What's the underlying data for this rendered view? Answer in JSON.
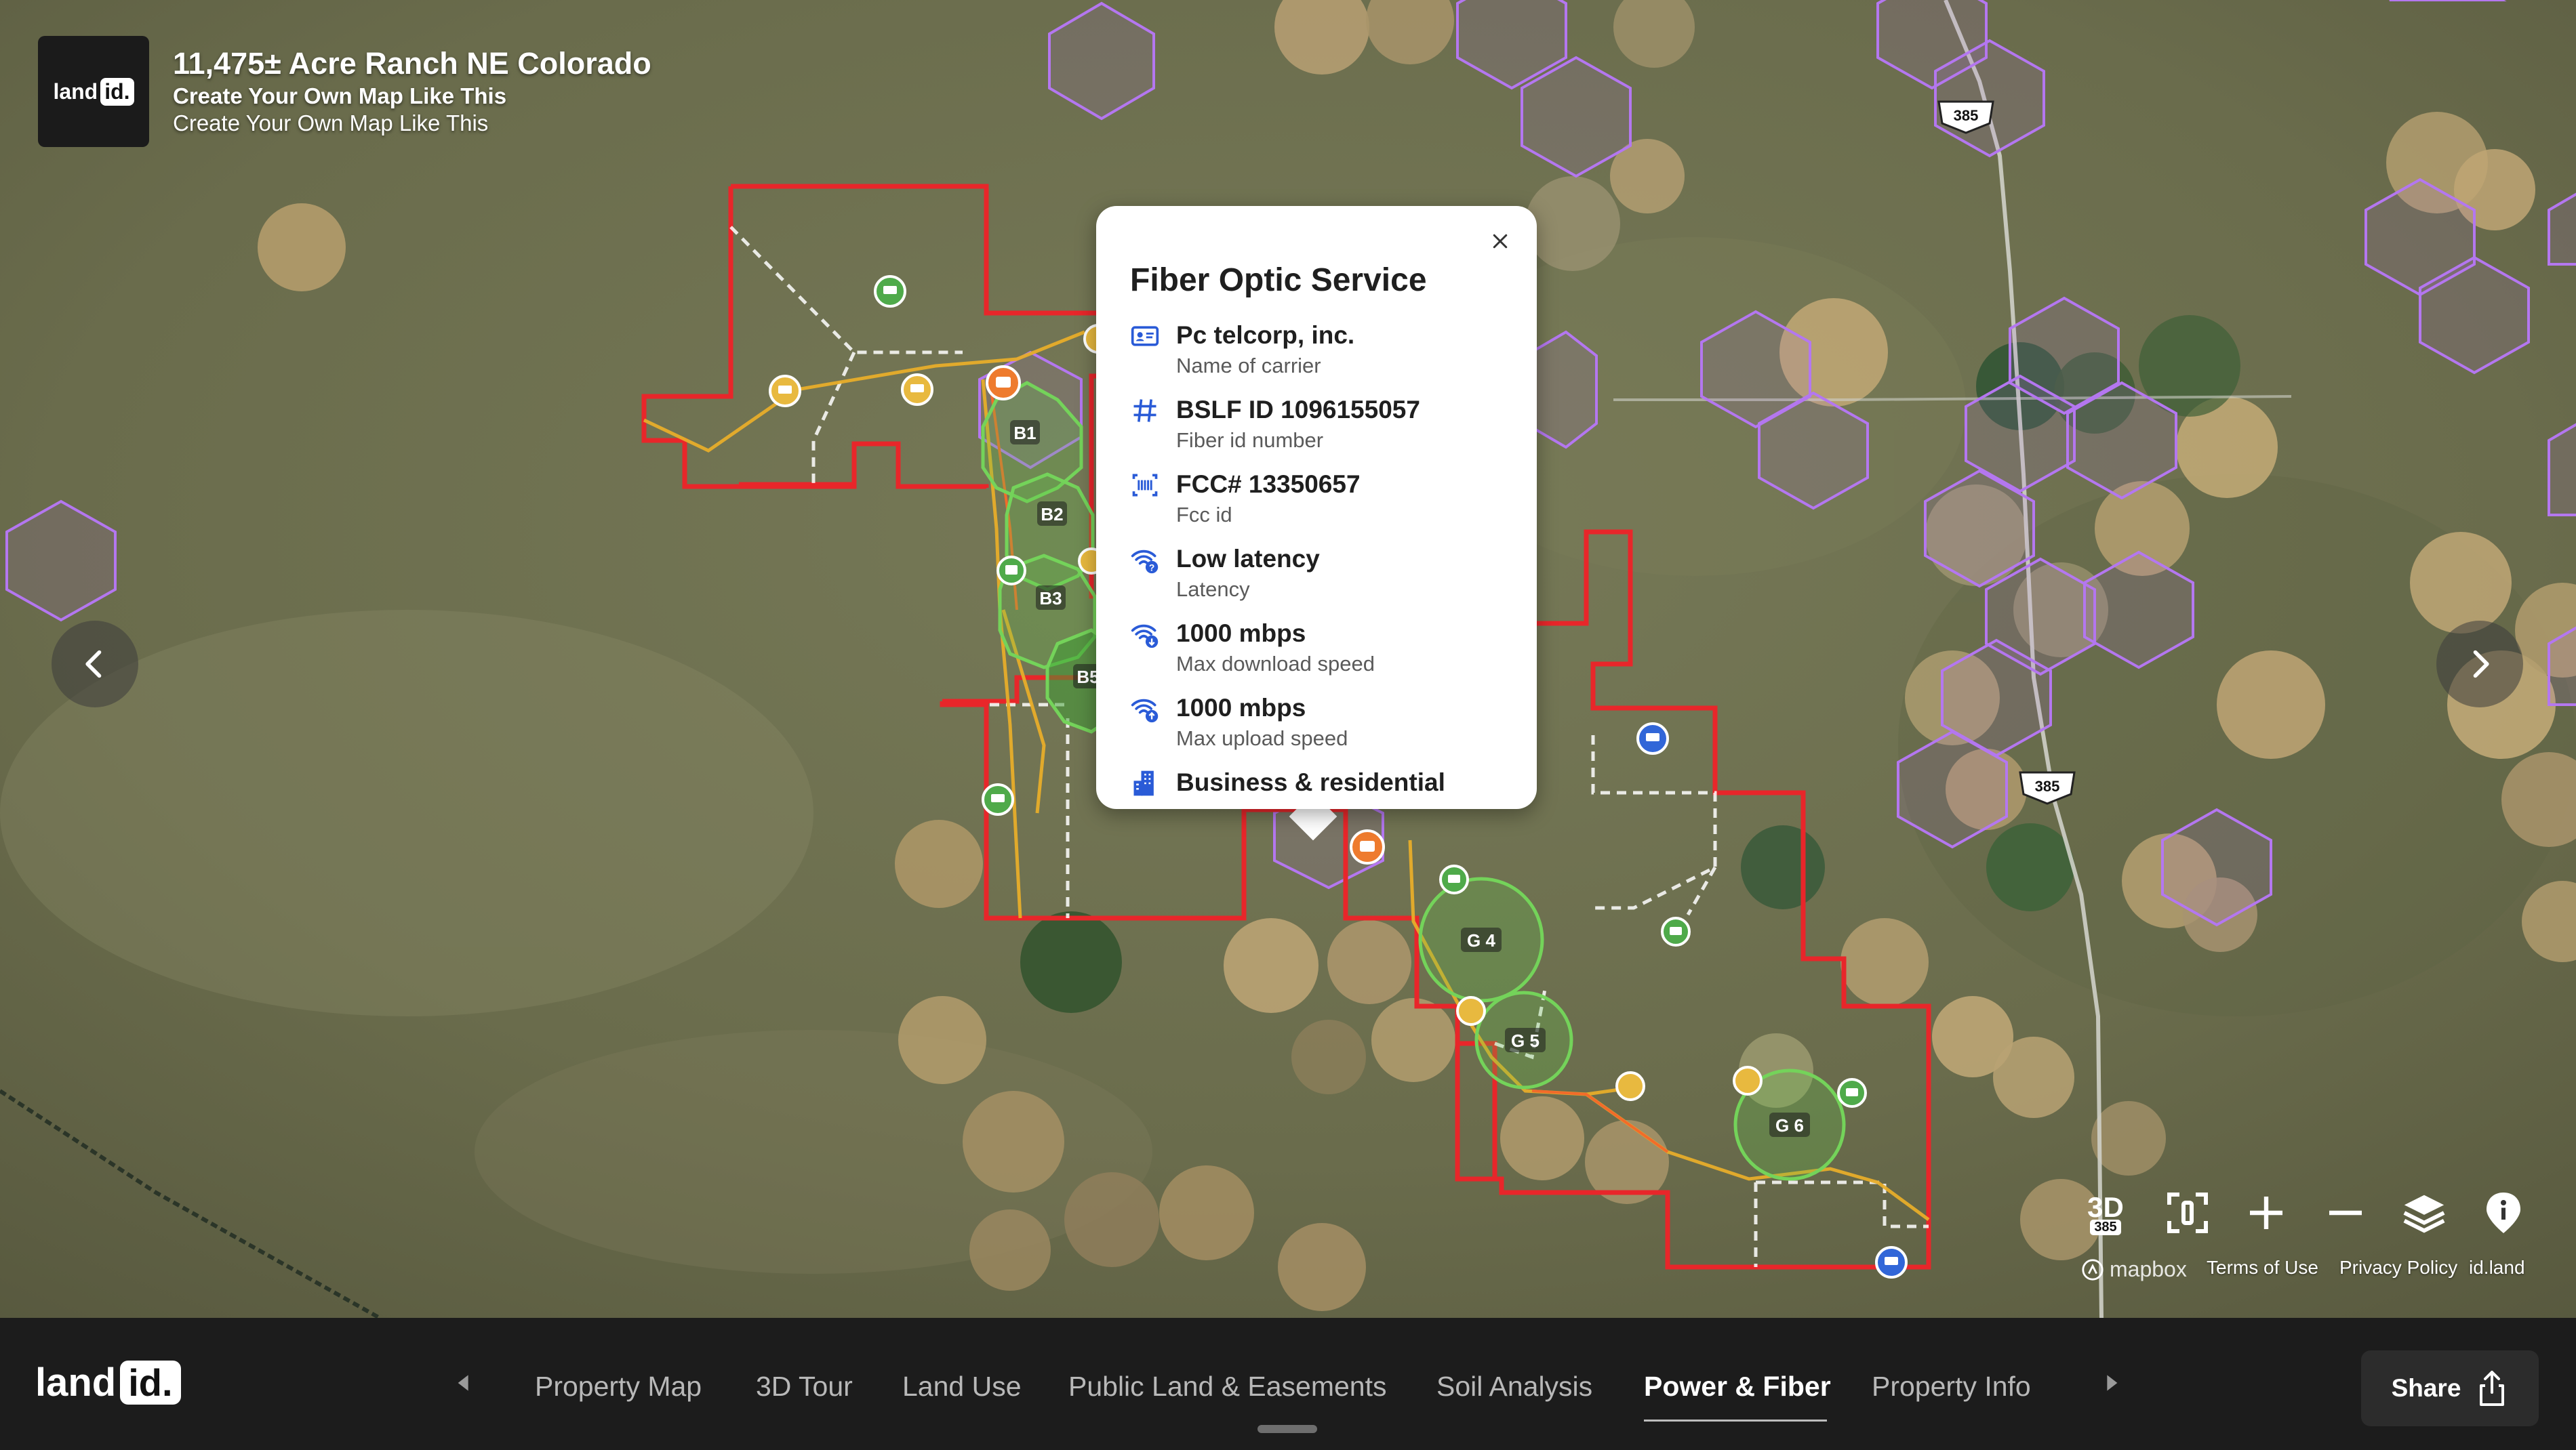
{
  "header": {
    "logo_text": "land",
    "logo_badge": "id.",
    "title": "11,475± Acre Ranch NE Colorado",
    "subtitle_bold": "Create Your Own Map Like This",
    "subtitle": "Create Your Own Map Like This"
  },
  "popup": {
    "title": "Fiber Optic Service",
    "rows": [
      {
        "icon": "id-card-icon",
        "value": "Pc telcorp, inc.",
        "label": "Name of carrier"
      },
      {
        "icon": "hash-icon",
        "value": "BSLF ID 1096155057",
        "label": "Fiber id number"
      },
      {
        "icon": "barcode-icon",
        "value": "FCC# 13350657",
        "label": "Fcc id"
      },
      {
        "icon": "wifi-question-icon",
        "value": "Low latency",
        "label": "Latency"
      },
      {
        "icon": "wifi-download-icon",
        "value": "1000 mbps",
        "label": "Max download speed"
      },
      {
        "icon": "wifi-upload-icon",
        "value": "1000 mbps",
        "label": "Max upload speed"
      },
      {
        "icon": "building-icon",
        "value": "Business & residential",
        "label": ""
      }
    ]
  },
  "map": {
    "parcel_labels": [
      "B1",
      "B2",
      "B3",
      "B5",
      "G 4",
      "G 5",
      "G 6"
    ],
    "highway_shields": [
      "385",
      "385",
      "385"
    ],
    "colors": {
      "boundary": "#e8262a",
      "hexagon": "#b477f0",
      "parcel_fill": "#5fc34a",
      "road": "#e7ad2a",
      "marker_green": "#4faa4a",
      "marker_yellow": "#e8b93f",
      "marker_orange": "#ee7b2e",
      "marker_blue": "#3166d8"
    }
  },
  "controls": {
    "three_d": "3D",
    "three_d_shield": "385",
    "mapbox": "mapbox",
    "terms": "Terms of Use",
    "privacy": "Privacy Policy",
    "idland": "id.land"
  },
  "bottom_bar": {
    "logo_text": "land",
    "logo_badge": "id.",
    "tabs": [
      "Property Map",
      "3D Tour",
      "Land Use",
      "Public Land & Easements",
      "Soil Analysis",
      "Power & Fiber",
      "Property Info"
    ],
    "active_tab": "Power & Fiber",
    "share_label": "Share"
  }
}
